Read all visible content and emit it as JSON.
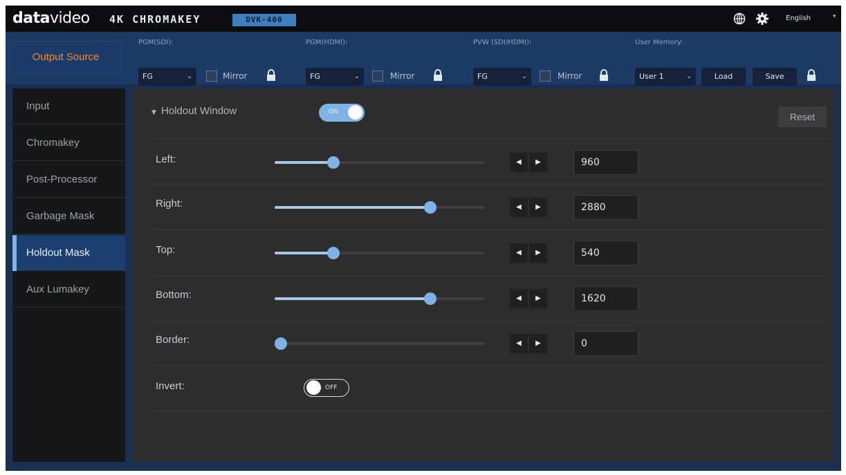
{
  "topbar": {
    "brand_a": "data",
    "brand_b": "video",
    "product": "4K CHROMAKEY",
    "model": "DVK-400",
    "language": "English",
    "icons": {
      "globe": "globe-icon",
      "settings": "gear-icon",
      "language_caret": "chevron-down-icon"
    }
  },
  "output_bar": {
    "output_source": "Output Source",
    "groups": [
      {
        "label": "PGM(SDI):",
        "selected": "FG",
        "mirror": "Mirror",
        "mirror_checked": false
      },
      {
        "label": "PGM(HDMI):",
        "selected": "FG",
        "mirror": "Mirror",
        "mirror_checked": false
      },
      {
        "label": "PVW (SDI/HDMI):",
        "selected": "FG",
        "mirror": "Mirror",
        "mirror_checked": false
      }
    ],
    "user_memory": {
      "label": "User Memory:",
      "selected": "User 1",
      "load": "Load",
      "save": "Save"
    },
    "colors": {
      "output_source_text": "#f08a2a",
      "bar_bg": "#1e3a66"
    }
  },
  "sidebar": {
    "items": [
      {
        "label": "Input",
        "active": false
      },
      {
        "label": "Chromakey",
        "active": false
      },
      {
        "label": "Post-Processor",
        "active": false
      },
      {
        "label": "Garbage Mask",
        "active": false
      },
      {
        "label": "Holdout Mask",
        "active": true
      },
      {
        "label": "Aux Lumakey",
        "active": false
      }
    ],
    "colors": {
      "active_bg": "#1b3f6e",
      "active_indicator": "#7fb6e8"
    }
  },
  "main": {
    "holdout_window": {
      "title": "Holdout Window",
      "toggle_label": "ON",
      "enabled": true
    },
    "reset": "Reset",
    "params": [
      {
        "label": "Left:",
        "value": "960",
        "fraction": 0.28
      },
      {
        "label": "Right:",
        "value": "2880",
        "fraction": 0.74
      },
      {
        "label": "Top:",
        "value": "540",
        "fraction": 0.28
      },
      {
        "label": "Bottom:",
        "value": "1620",
        "fraction": 0.74
      },
      {
        "label": "Border:",
        "value": "0",
        "fraction": 0.03
      }
    ],
    "invert": {
      "label": "Invert:",
      "toggle_label": "OFF",
      "enabled": false
    },
    "colors": {
      "accent": "#7fb3e6",
      "panel_bg": "#2d2d2e"
    }
  }
}
